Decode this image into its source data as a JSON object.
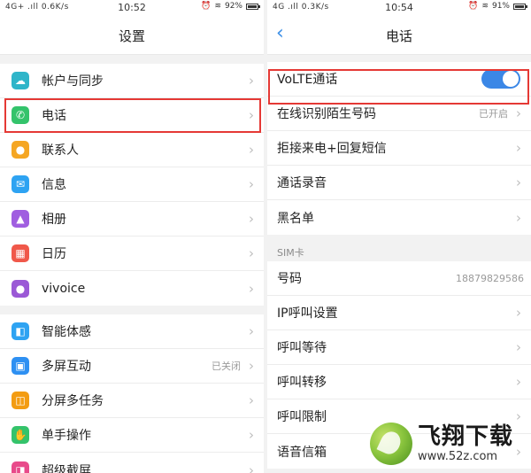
{
  "left": {
    "status": {
      "signal": "4G+ .ıll  0.6K/s",
      "time": "10:52",
      "battery": "92%"
    },
    "title": "设置",
    "group1": [
      {
        "label": "帐户与同步",
        "icon": "cloud-icon",
        "color": "#2fb5c9",
        "glyph": "☁"
      },
      {
        "label": "电话",
        "icon": "phone-icon",
        "color": "#34c36b",
        "glyph": "✆"
      },
      {
        "label": "联系人",
        "icon": "contacts-icon",
        "color": "#f5a623",
        "glyph": "●"
      },
      {
        "label": "信息",
        "icon": "message-icon",
        "color": "#2ea3f2",
        "glyph": "✉"
      },
      {
        "label": "相册",
        "icon": "album-icon",
        "color": "#a05ee0",
        "glyph": "▲"
      },
      {
        "label": "日历",
        "icon": "calendar-icon",
        "color": "#f0584a",
        "glyph": "▦"
      },
      {
        "label": "vivoice",
        "icon": "microphone-icon",
        "color": "#9b59d6",
        "glyph": "●"
      }
    ],
    "group2": [
      {
        "label": "智能体感",
        "icon": "motion-icon",
        "color": "#2ea3f2",
        "glyph": "◧",
        "value": ""
      },
      {
        "label": "多屏互动",
        "icon": "multiscreen-icon",
        "color": "#2e90f2",
        "glyph": "▣",
        "value": "已关闭"
      },
      {
        "label": "分屏多任务",
        "icon": "splitscreen-icon",
        "color": "#f39c12",
        "glyph": "◫",
        "value": ""
      },
      {
        "label": "单手操作",
        "icon": "onehand-icon",
        "color": "#34c36b",
        "glyph": "✋",
        "value": ""
      },
      {
        "label": "超级截屏",
        "icon": "screenshot-icon",
        "color": "#e84a8a",
        "glyph": "◨",
        "value": ""
      }
    ]
  },
  "right": {
    "status": {
      "signal": "4G .ıll  0.3K/s",
      "time": "10:54",
      "battery": "91%"
    },
    "title": "电话",
    "volte": {
      "label": "VoLTE通话",
      "enabled": true
    },
    "group1": [
      {
        "label": "在线识别陌生号码",
        "value": "已开启"
      },
      {
        "label": "拒接来电+回复短信",
        "value": ""
      },
      {
        "label": "通话录音",
        "value": ""
      },
      {
        "label": "黑名单",
        "value": ""
      }
    ],
    "sim_header": "SIM卡",
    "group2": [
      {
        "label": "号码",
        "value": "18879829586",
        "chevron": false
      },
      {
        "label": "IP呼叫设置",
        "value": "",
        "chevron": true
      },
      {
        "label": "呼叫等待",
        "value": "",
        "chevron": true
      },
      {
        "label": "呼叫转移",
        "value": "",
        "chevron": true
      },
      {
        "label": "呼叫限制",
        "value": "",
        "chevron": true
      },
      {
        "label": "语音信箱",
        "value": "",
        "chevron": true
      }
    ]
  },
  "chevron": "›",
  "back_glyph": "‹",
  "colors": {
    "highlight": "#e53935",
    "toggle": "#3b87e6",
    "accent": "#3a8ee6"
  },
  "watermark": {
    "main": "飞翔下载",
    "url": "www.52z.com"
  }
}
